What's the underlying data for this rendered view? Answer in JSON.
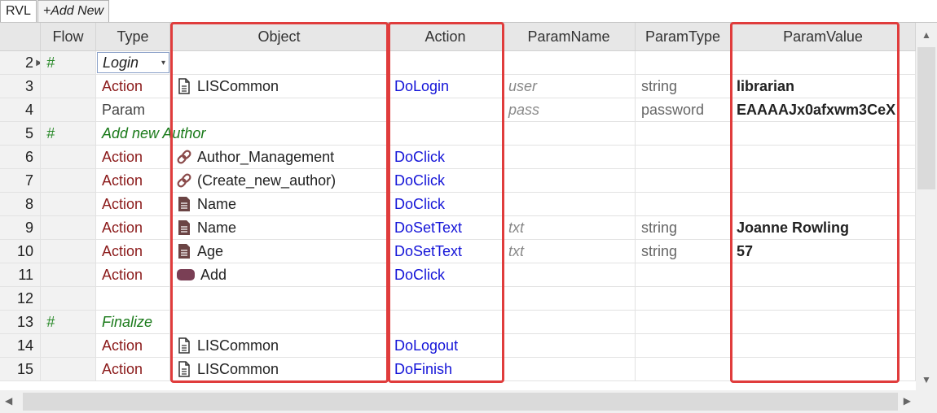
{
  "tabs": [
    {
      "label": "RVL"
    },
    {
      "label": "+Add New"
    }
  ],
  "columns": {
    "flow": "Flow",
    "type": "Type",
    "object": "Object",
    "action": "Action",
    "param_name": "ParamName",
    "param_type": "ParamType",
    "param_value": "ParamValue"
  },
  "rows": [
    {
      "num": "2",
      "flow": "#",
      "type": "Login",
      "object": "",
      "action": "",
      "param_name": "",
      "param_type": "",
      "param_value": ""
    },
    {
      "num": "3",
      "flow": "",
      "type": "Action",
      "object": "LISCommon",
      "action": "DoLogin",
      "param_name": "user",
      "param_type": "string",
      "param_value": "librarian"
    },
    {
      "num": "4",
      "flow": "",
      "type": "Param",
      "object": "",
      "action": "",
      "param_name": "pass",
      "param_type": "password",
      "param_value": "EAAAAJx0afxwm3CeX"
    },
    {
      "num": "5",
      "flow": "#",
      "type": "Add new Author",
      "object": "",
      "action": "",
      "param_name": "",
      "param_type": "",
      "param_value": ""
    },
    {
      "num": "6",
      "flow": "",
      "type": "Action",
      "object": "Author_Management",
      "action": "DoClick",
      "param_name": "",
      "param_type": "",
      "param_value": ""
    },
    {
      "num": "7",
      "flow": "",
      "type": "Action",
      "object": "(Create_new_author)",
      "action": "DoClick",
      "param_name": "",
      "param_type": "",
      "param_value": ""
    },
    {
      "num": "8",
      "flow": "",
      "type": "Action",
      "object": "Name",
      "action": "DoClick",
      "param_name": "",
      "param_type": "",
      "param_value": ""
    },
    {
      "num": "9",
      "flow": "",
      "type": "Action",
      "object": "Name",
      "action": "DoSetText",
      "param_name": "txt",
      "param_type": "string",
      "param_value": "Joanne Rowling"
    },
    {
      "num": "10",
      "flow": "",
      "type": "Action",
      "object": "Age",
      "action": "DoSetText",
      "param_name": "txt",
      "param_type": "string",
      "param_value": "57"
    },
    {
      "num": "11",
      "flow": "",
      "type": "Action",
      "object": "Add",
      "action": "DoClick",
      "param_name": "",
      "param_type": "",
      "param_value": ""
    },
    {
      "num": "12",
      "flow": "",
      "type": "",
      "object": "",
      "action": "",
      "param_name": "",
      "param_type": "",
      "param_value": ""
    },
    {
      "num": "13",
      "flow": "#",
      "type": "Finalize",
      "object": "",
      "action": "",
      "param_name": "",
      "param_type": "",
      "param_value": ""
    },
    {
      "num": "14",
      "flow": "",
      "type": "Action",
      "object": "LISCommon",
      "action": "DoLogout",
      "param_name": "",
      "param_type": "",
      "param_value": ""
    },
    {
      "num": "15",
      "flow": "",
      "type": "Action",
      "object": "LISCommon",
      "action": "DoFinish",
      "param_name": "",
      "param_type": "",
      "param_value": ""
    }
  ],
  "icons": {
    "row3": "document-icon",
    "row6": "link-icon",
    "row7": "link-icon",
    "row8": "textbox-icon",
    "row9": "textbox-icon",
    "row10": "textbox-icon",
    "row11": "button-icon",
    "row14": "document-icon",
    "row15": "document-icon"
  },
  "colors": {
    "highlight": "#e03c3c",
    "action_type": "#8b1a1a",
    "action_link": "#1414d8",
    "comment": "#1a7a1a"
  }
}
